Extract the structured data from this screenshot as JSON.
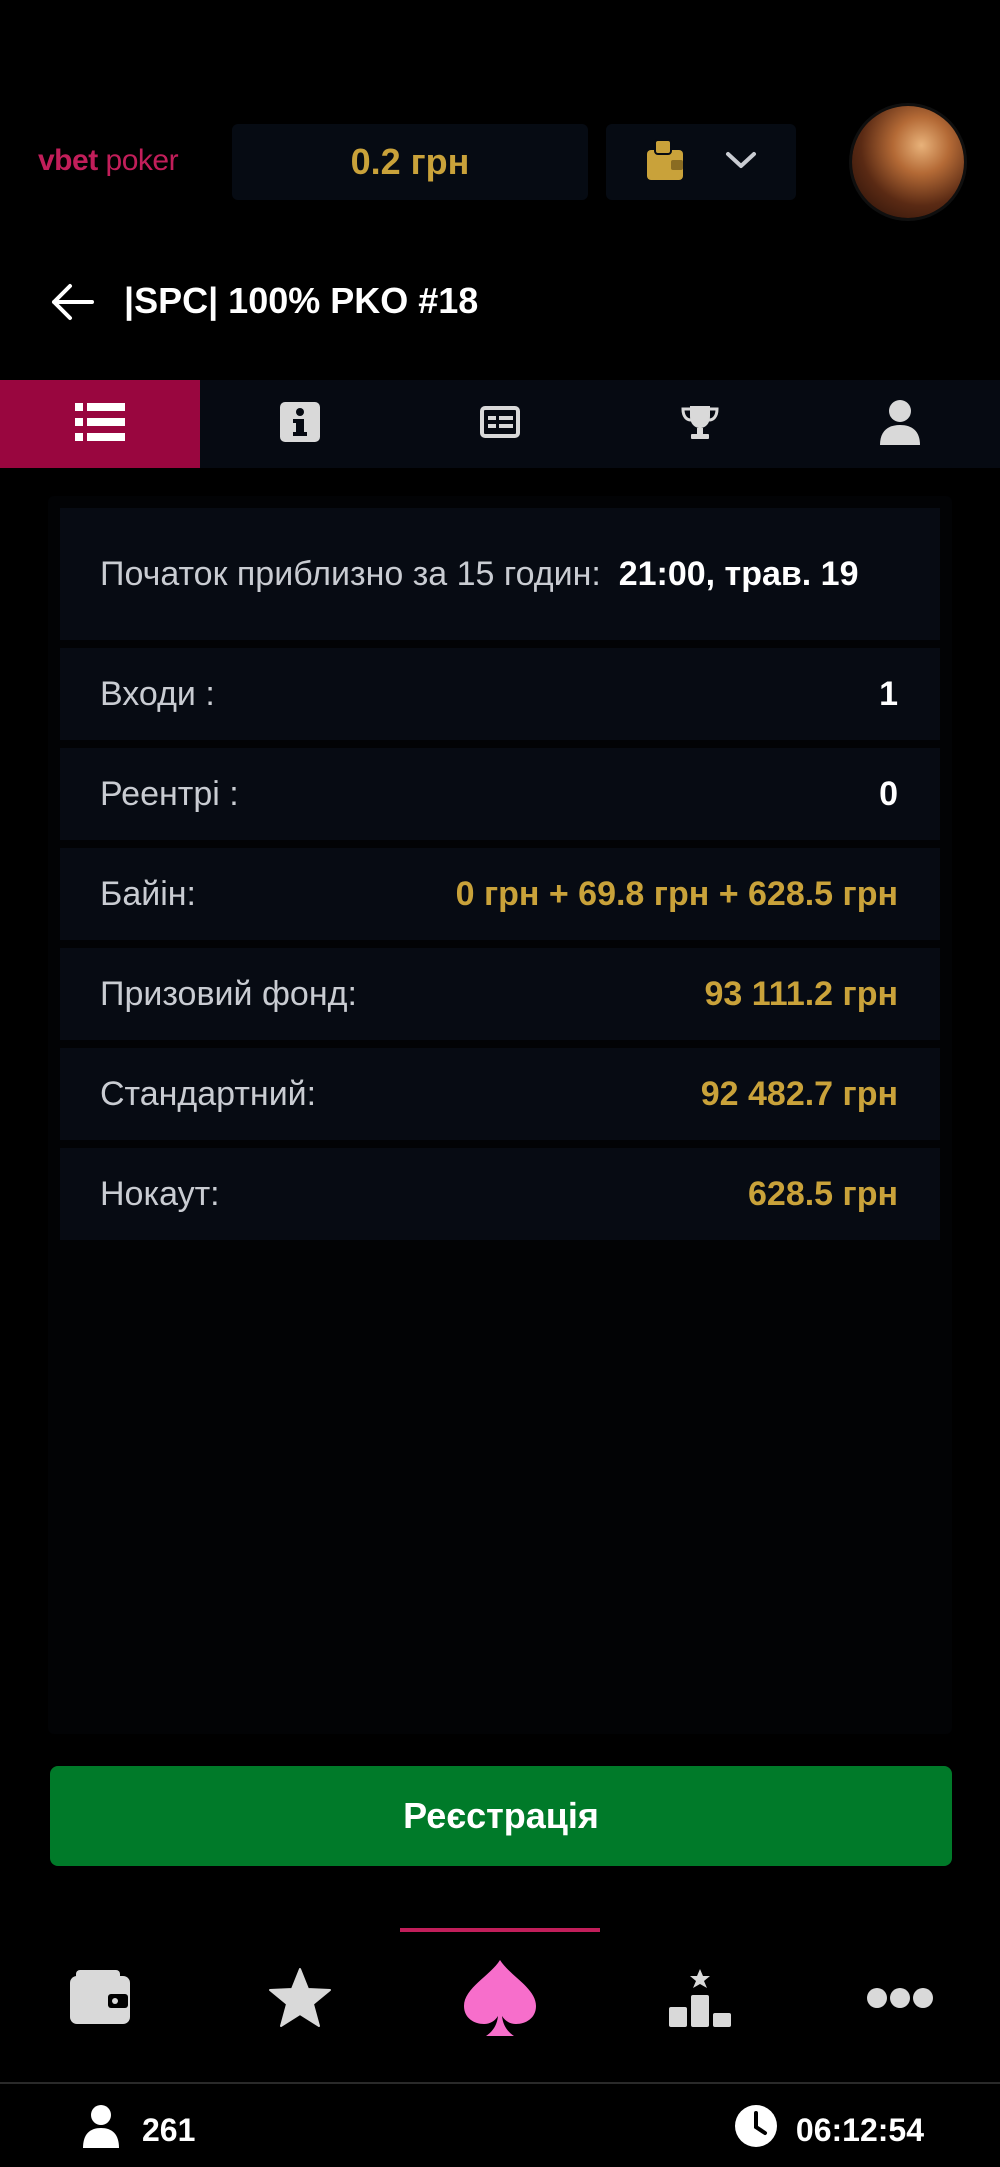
{
  "header": {
    "logo_brand": "vbet",
    "logo_product": "poker",
    "balance": "0.2 грн",
    "wallet_icon": "wallet-icon",
    "dropdown_icon": "chevron-down-icon"
  },
  "title_bar": {
    "back_icon": "arrow-left-icon",
    "title": "|SPC| 100% PKO #18"
  },
  "tabs": [
    {
      "icon": "list-icon",
      "active": true
    },
    {
      "icon": "info-icon",
      "active": false
    },
    {
      "icon": "table-card-icon",
      "active": false
    },
    {
      "icon": "trophy-icon",
      "active": false
    },
    {
      "icon": "user-icon",
      "active": false
    }
  ],
  "info": {
    "start_label": "Початок приблизно за 15 годин:",
    "start_value": "21:00, трав. 19",
    "entries_label": "Входи :",
    "entries_value": "1",
    "reentries_label": "Реентрі :",
    "reentries_value": "0",
    "buyin_label": "Байін:",
    "buyin_value": "0 грн + 69.8 грн + 628.5 грн",
    "prize_label": "Призовий фонд:",
    "prize_value": "93 111.2 грн",
    "standard_label": "Стандартний:",
    "standard_value": "92 482.7 грн",
    "knockout_label": "Нокаут:",
    "knockout_value": "628.5 грн"
  },
  "register_label": "Реєстрація",
  "bottom_nav": [
    {
      "icon": "wallet-icon",
      "active": false
    },
    {
      "icon": "star-icon",
      "active": false
    },
    {
      "icon": "spade-icon",
      "active": true
    },
    {
      "icon": "leaderboard-icon",
      "active": false
    },
    {
      "icon": "more-icon",
      "active": false
    }
  ],
  "status_bar": {
    "players_count": "261",
    "time": "06:12:54"
  },
  "colors": {
    "accent": "#c21e5a",
    "gold": "#c9a23a",
    "register_green": "#007a29",
    "active_tab": "#99063f"
  }
}
